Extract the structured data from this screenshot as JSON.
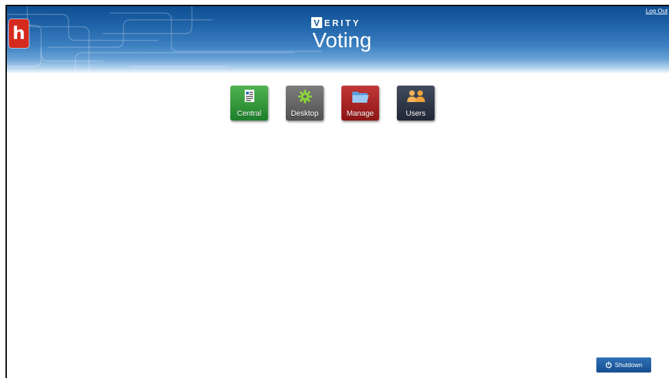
{
  "header": {
    "logo_text": "h",
    "brand_initial": "V",
    "brand_rest": "ERITY",
    "title": "Voting",
    "logout_label": "Log Out"
  },
  "apps": [
    {
      "label": "Central",
      "icon": "document-icon",
      "color": "#2a8f36"
    },
    {
      "label": "Desktop",
      "icon": "gear-icon",
      "color": "#626262"
    },
    {
      "label": "Manage",
      "icon": "folder-icon",
      "color": "#a82222"
    },
    {
      "label": "Users",
      "icon": "users-icon",
      "color": "#2c3444"
    }
  ],
  "footer": {
    "shutdown_label": "Shutdown",
    "shutdown_icon": "power-icon"
  },
  "colors": {
    "header_top": "#0e4f93",
    "logo_red": "#d52b1e",
    "shutdown_blue": "#2060a5"
  }
}
